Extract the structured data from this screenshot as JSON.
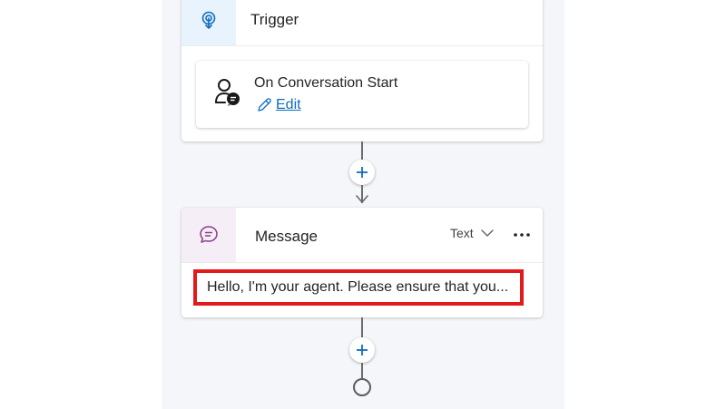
{
  "trigger": {
    "title": "Trigger",
    "icon": "touch-icon",
    "event": {
      "title": "On Conversation Start",
      "icon": "person-chat-icon",
      "edit_label": "Edit"
    }
  },
  "message": {
    "title": "Message",
    "icon": "chat-bubble-icon",
    "type_label": "Text",
    "text": "Hello, I'm your agent. Please ensure that you..."
  },
  "colors": {
    "accent": "#0f6cbd",
    "highlight": "#e31a1c",
    "trigger_icon_bg": "#e8f3fe",
    "message_icon_bg": "#f5eef6"
  }
}
